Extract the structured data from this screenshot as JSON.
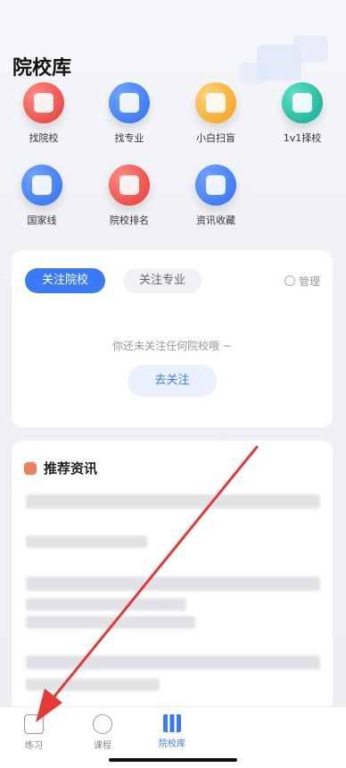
{
  "page_title": "院校库",
  "quick_actions": [
    {
      "label": "找院校",
      "color": "red"
    },
    {
      "label": "找专业",
      "color": "blue"
    },
    {
      "label": "小白扫盲",
      "color": "orange"
    },
    {
      "label": "1v1择校",
      "color": "teal"
    },
    {
      "label": "国家线",
      "color": "blue"
    },
    {
      "label": "院校排名",
      "color": "red"
    },
    {
      "label": "资讯收藏",
      "color": "blue"
    }
  ],
  "follow_card": {
    "tab_active": "关注院校",
    "tab_inactive": "关注专业",
    "manage_label": "管理",
    "empty_text": "你还未关注任何院校哦 ~",
    "follow_button": "去关注"
  },
  "news": {
    "heading": "推荐资讯"
  },
  "tabbar": {
    "items": [
      {
        "label": "练习"
      },
      {
        "label": "课程"
      },
      {
        "label": "院校库"
      }
    ],
    "active_index": 2
  },
  "annotation_color": "#e53935"
}
